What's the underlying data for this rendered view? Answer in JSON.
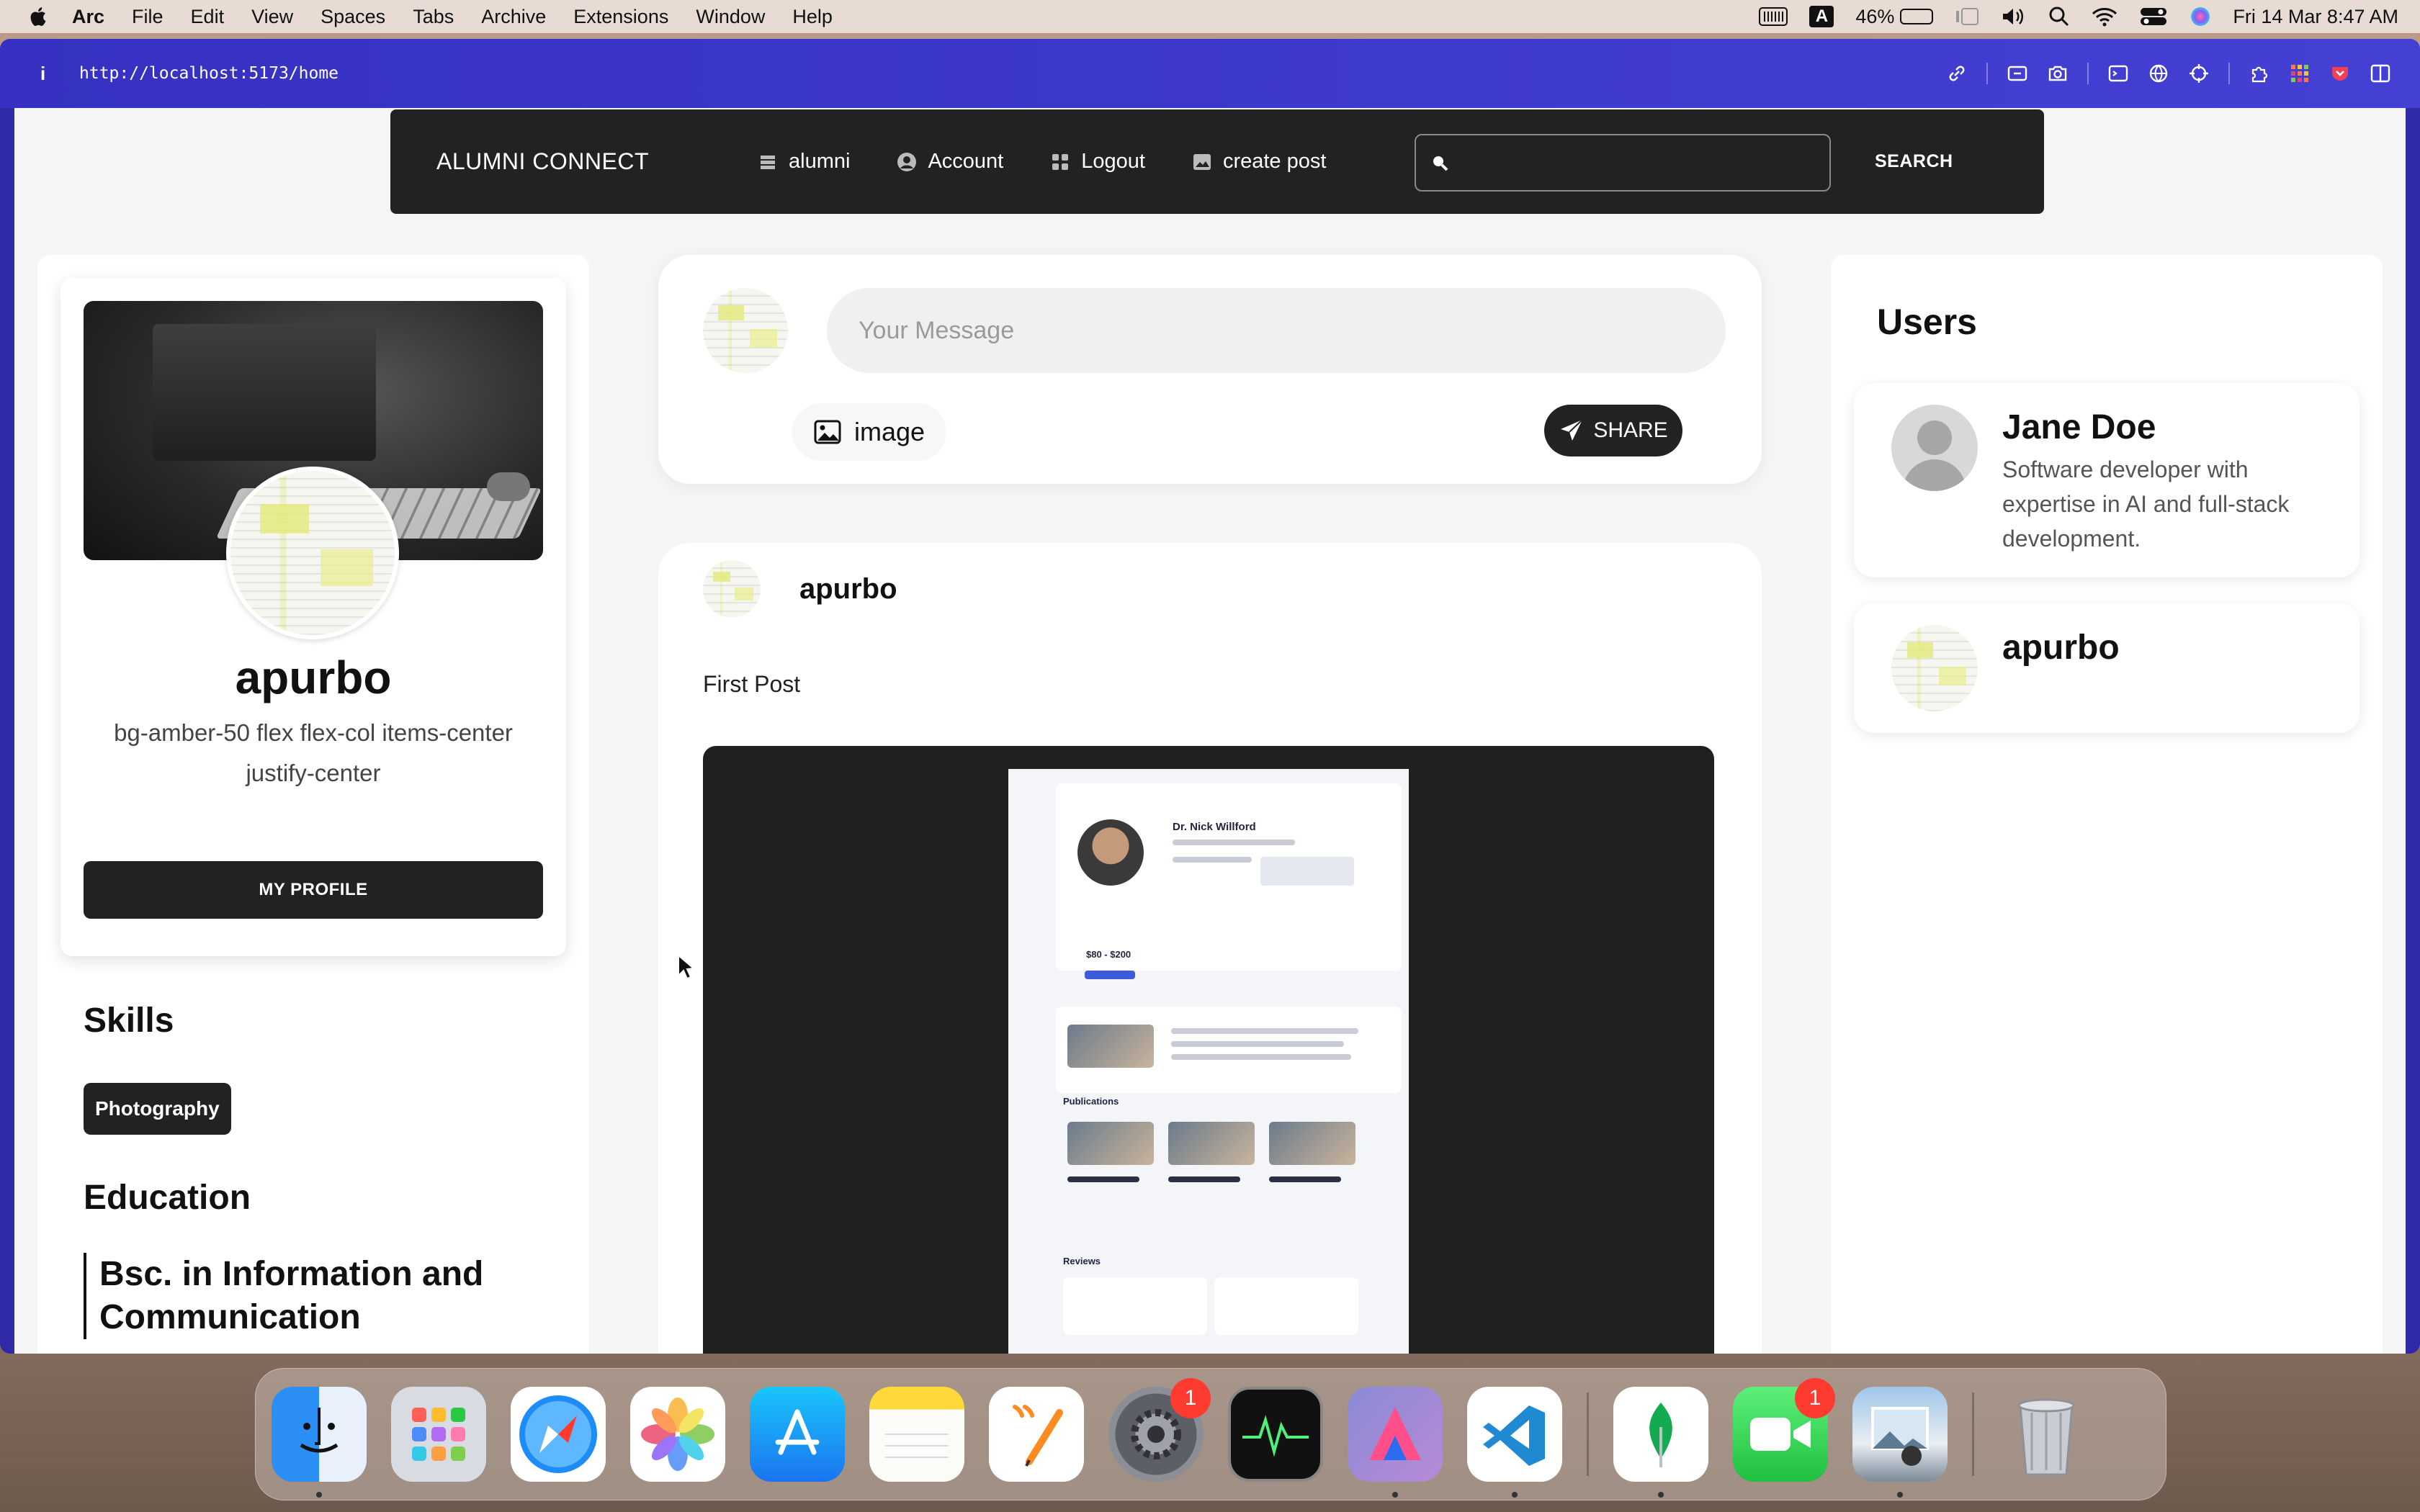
{
  "menubar": {
    "app_name": "Arc",
    "items": [
      "File",
      "Edit",
      "View",
      "Spaces",
      "Tabs",
      "Archive",
      "Extensions",
      "Window",
      "Help"
    ],
    "keyboard_badge": "A",
    "battery_percent": "46%",
    "battery_level": 0.46,
    "datetime": "Fri 14 Mar  8:47 AM"
  },
  "browser": {
    "info_glyph": "i",
    "url": "http://localhost:5173/home"
  },
  "navbar": {
    "brand": "ALUMNI CONNECT",
    "links": {
      "alumni": "alumni",
      "account": "Account",
      "logout": "Logout",
      "create_post": "create post"
    },
    "search_value": "",
    "search_button": "SEARCH"
  },
  "profile": {
    "name": "apurbo",
    "bio": "bg-amber-50 flex flex-col items-center justify-center",
    "button": "MY PROFILE",
    "skills_title": "Skills",
    "skills": [
      "Photography"
    ],
    "education_title": "Education",
    "education": [
      "Bsc. in Information and Communication"
    ]
  },
  "composer": {
    "placeholder": "Your Message",
    "image_label": "image",
    "share_label": "SHARE"
  },
  "post": {
    "author": "apurbo",
    "content": "First Post",
    "screenshot_doctor": "Dr. Nick Willford",
    "screenshot_price": "$80 - $200",
    "screenshot_publications": "Publications",
    "screenshot_reviews": "Reviews"
  },
  "users": {
    "title": "Users",
    "list": [
      {
        "name": "Jane Doe",
        "bio": "Software developer with expertise in AI and full-stack development."
      },
      {
        "name": "apurbo",
        "bio": ""
      }
    ]
  },
  "dock": {
    "apps": [
      "Finder",
      "Launchpad",
      "Safari",
      "Photos",
      "App Store",
      "Notes",
      "Pages",
      "System Settings",
      "Activity Monitor",
      "Affinity",
      "Visual Studio Code",
      "MongoDB Compass",
      "FaceTime",
      "Preview",
      "Trash"
    ],
    "settings_badge": "1",
    "facetime_badge": "1"
  },
  "colors": {
    "arc_bar": "#3631c2",
    "navbar_bg": "#222222",
    "page_bg": "#f5f5f5",
    "badge_red": "#ff3b30"
  }
}
